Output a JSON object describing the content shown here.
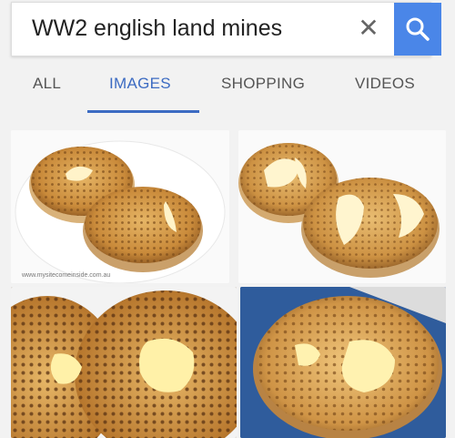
{
  "search": {
    "query": "WW2 english land mines",
    "clear_icon": "close-icon",
    "submit_icon": "search-icon",
    "accent_color": "#4a86e8"
  },
  "tabs": [
    {
      "label": "ALL",
      "active": false
    },
    {
      "label": "IMAGES",
      "active": true
    },
    {
      "label": "SHOPPING",
      "active": false
    },
    {
      "label": "VIDEOS",
      "active": false
    }
  ],
  "results": {
    "image_1_caption": "www.mysitecomeinside.com.au"
  }
}
